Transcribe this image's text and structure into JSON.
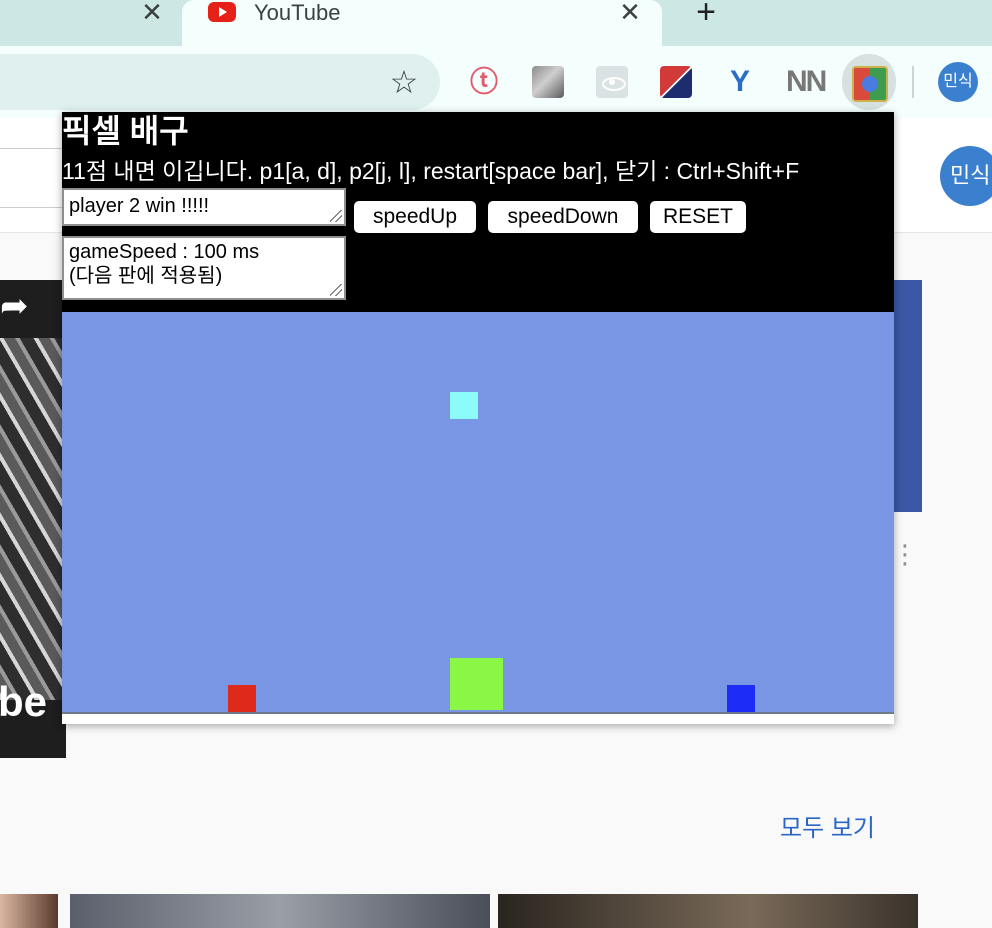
{
  "browser": {
    "tabs": [
      {
        "label": ""
      },
      {
        "label": "YouTube"
      }
    ],
    "close_glyph": "✕",
    "new_tab_glyph": "+",
    "star_glyph": "☆",
    "extensions": [
      {
        "icon": "twice-icon",
        "glyph": "ⓣ"
      },
      {
        "icon": "photo-extension-icon"
      },
      {
        "icon": "react-devtools-icon"
      },
      {
        "icon": "flag-extension-icon"
      },
      {
        "icon": "y-extension-icon",
        "glyph": "Y"
      },
      {
        "icon": "n-extension-icon",
        "glyph": "NN"
      },
      {
        "icon": "pixel-volleyball-extension-icon"
      }
    ],
    "profile_label": "민식"
  },
  "youtube": {
    "avatar_label": "민식",
    "see_all_label": "모두 보기",
    "thumb_arrow": "➦",
    "thumb_text": "be",
    "kebab_glyph": "⋮"
  },
  "popup": {
    "title": "픽셀 배구",
    "instructions": "11점 내면 이깁니다. p1[a, d], p2[j, l], restart[space bar], 닫기 : Ctrl+Shift+F",
    "status_value": "player 2 win !!!!!",
    "speed_value": "gameSpeed : 100 ms\n(다음 판에 적용됨)",
    "buttons": {
      "speed_up": "speedUp",
      "speed_down": "speedDown",
      "reset": "RESET"
    }
  },
  "colors": {
    "court": "#7896e4",
    "ball": "#8cfbf9",
    "net": "#8cf646",
    "player1": "#dd2a1a",
    "player2": "#1d2cf6"
  }
}
